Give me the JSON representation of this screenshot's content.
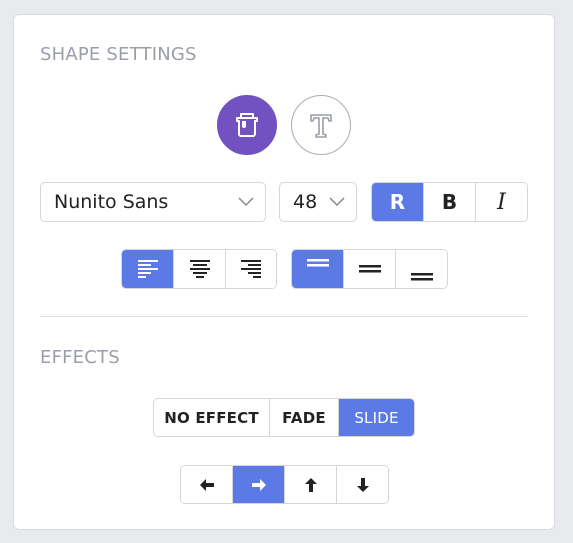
{
  "shape_settings": {
    "title": "SHAPE SETTINGS",
    "modes": [
      {
        "name": "paint-bucket-icon",
        "active": true
      },
      {
        "name": "text-icon",
        "active": false
      }
    ],
    "font_select": {
      "value": "Nunito Sans"
    },
    "size_select": {
      "value": "48"
    },
    "style_options": [
      "R",
      "B",
      "I"
    ],
    "style_selected": "R",
    "align_selected": "left",
    "spacing_selected": "top"
  },
  "effects": {
    "title": "EFFECTS",
    "options": [
      "NO EFFECT",
      "FADE",
      "SLIDE"
    ],
    "selected": "SLIDE",
    "directions": [
      "left",
      "right",
      "up",
      "down"
    ],
    "direction_selected": "right"
  },
  "colors": {
    "accent_blue": "#5b7ae6",
    "accent_purple": "#7152c0",
    "muted_text": "#9a9ea8"
  }
}
